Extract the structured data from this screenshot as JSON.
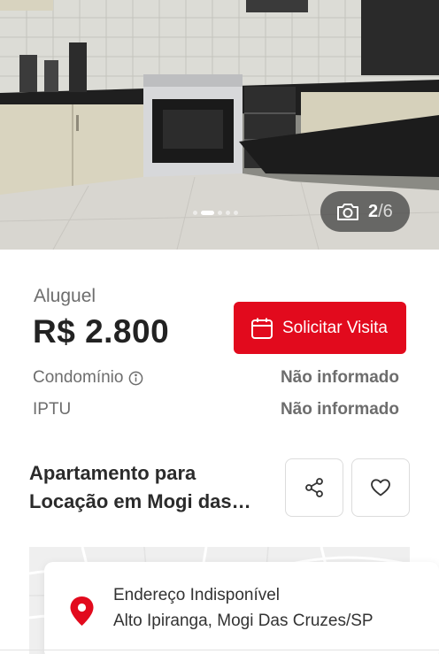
{
  "gallery": {
    "current": "2",
    "total": "/6",
    "slides": 5,
    "active_slide": 2,
    "icons": {
      "counter": "camera-icon"
    }
  },
  "pricing": {
    "type_label": "Aluguel",
    "price": "R$ 2.800",
    "visit_button_label": "Solicitar Visita",
    "fees": [
      {
        "label": "Condomínio",
        "value": "Não informado",
        "has_info_icon": true
      },
      {
        "label": "IPTU",
        "value": "Não informado",
        "has_info_icon": false
      }
    ]
  },
  "listing": {
    "title": "Apartamento para Locação em Mogi das Cruzes"
  },
  "actions": {
    "icons": {
      "share": "share-icon",
      "favorite": "heart-icon"
    }
  },
  "address": {
    "line1": "Endereço Indisponível",
    "line2": "Alto Ipiranga, Mogi Das Cruzes/SP"
  },
  "colors": {
    "accent": "#e20a1d",
    "text_primary": "#2b2b2b",
    "text_muted": "#6d6d6d"
  }
}
